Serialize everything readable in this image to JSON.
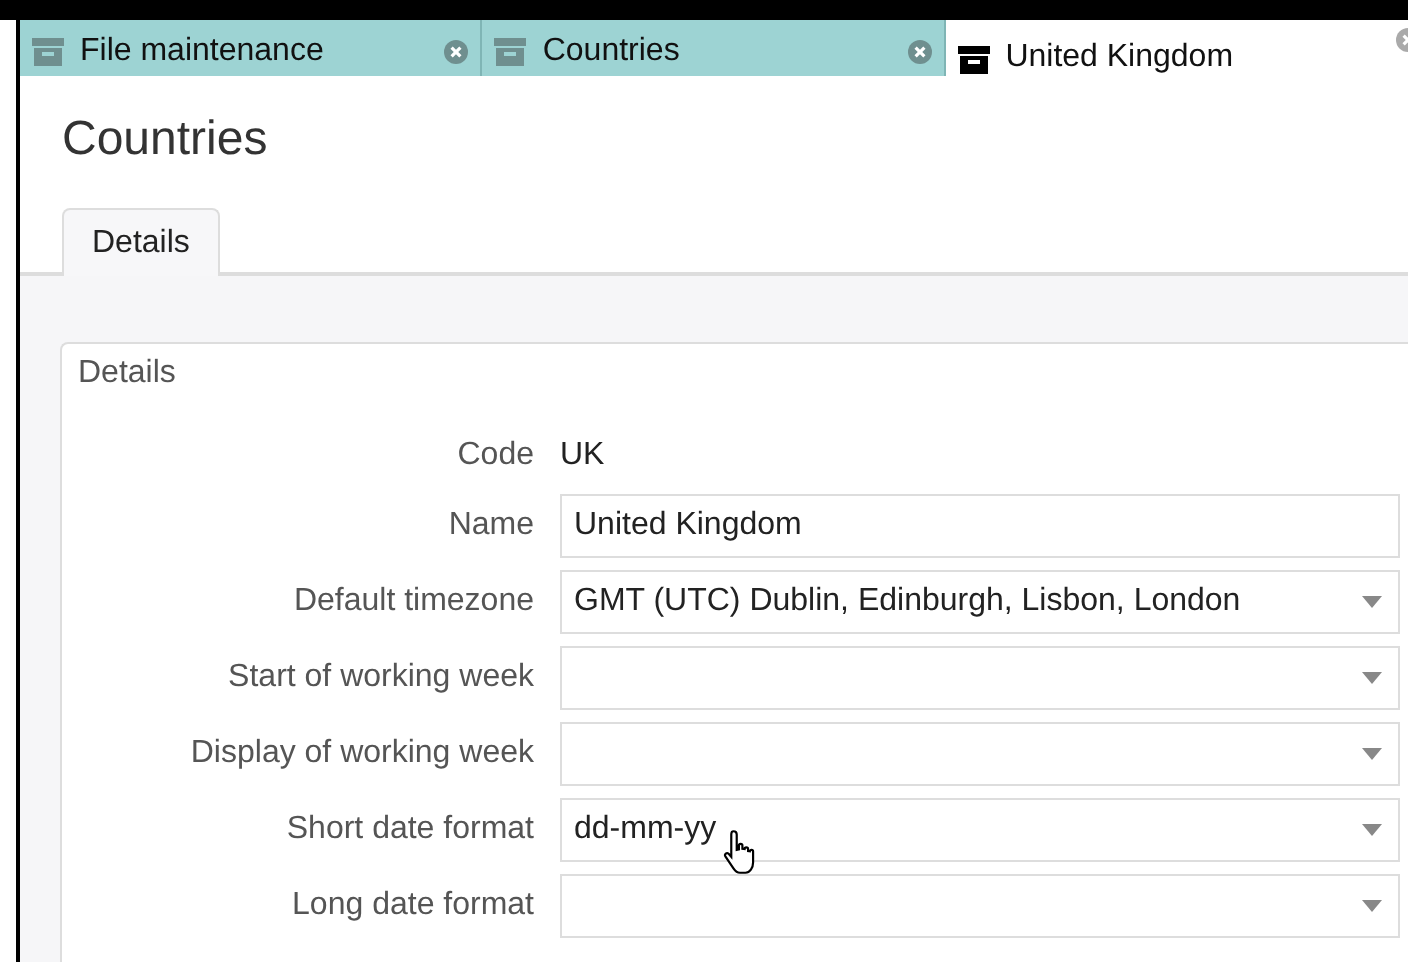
{
  "tabs": [
    {
      "label": "File maintenance",
      "selected": false,
      "closable": true
    },
    {
      "label": "Countries",
      "selected": false,
      "closable": true
    },
    {
      "label": "United Kingdom",
      "selected": true,
      "closable": true
    }
  ],
  "page_title": "Countries",
  "subtabs": [
    {
      "label": "Details",
      "selected": true
    }
  ],
  "section": {
    "title": "Details",
    "fields": [
      {
        "kind": "static",
        "label": "Code",
        "value": "UK"
      },
      {
        "kind": "input",
        "label": "Name",
        "value": "United Kingdom"
      },
      {
        "kind": "select",
        "label": "Default timezone",
        "value": "GMT (UTC) Dublin, Edinburgh, Lisbon, London"
      },
      {
        "kind": "select",
        "label": "Start of working week"
      },
      {
        "kind": "select",
        "label": "Display of working week"
      },
      {
        "kind": "select",
        "label": "Short date format",
        "value": "dd-mm-yy",
        "hovered": true
      },
      {
        "kind": "select",
        "label": "Long date format"
      }
    ]
  }
}
